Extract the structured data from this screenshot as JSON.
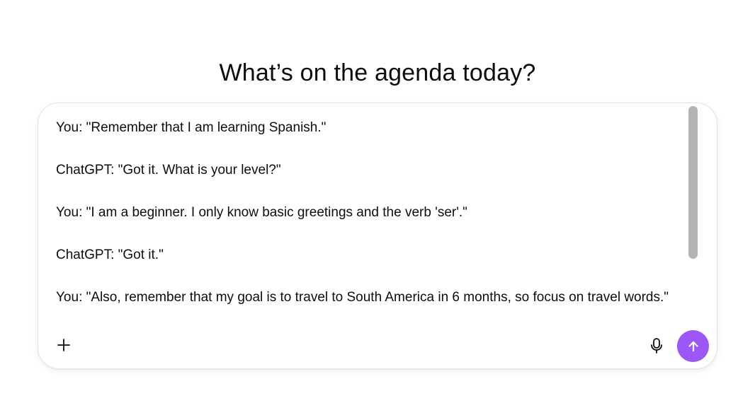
{
  "header": {
    "title": "What’s on the agenda today?"
  },
  "composer": {
    "lines": [
      "You: \"Remember that I am learning Spanish.\"",
      "ChatGPT: \"Got it. What is your level?\"",
      "You: \"I am a beginner. I only know basic greetings and the verb 'ser'.\"",
      "ChatGPT: \"Got it.\"",
      "You: \"Also, remember that my goal is to travel to South America in 6 months, so focus on travel words.\""
    ],
    "icons": {
      "attach": "plus-icon",
      "voice": "microphone-icon",
      "send": "arrow-up-icon"
    },
    "colors": {
      "send_button": "#9d57f7",
      "scrollbar_thumb": "#b4b4b4",
      "border": "#e3e3e3"
    }
  }
}
